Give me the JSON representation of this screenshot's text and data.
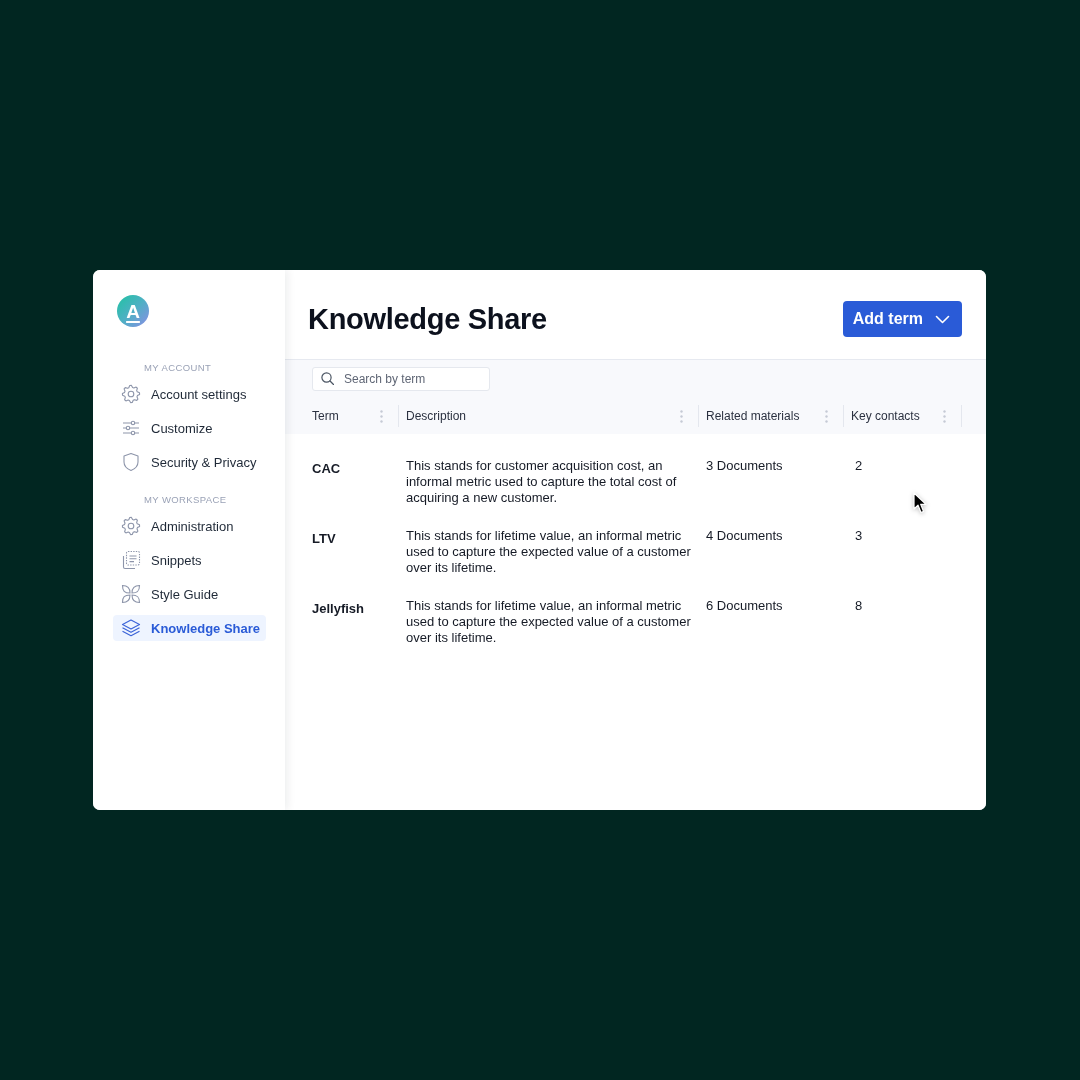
{
  "logo": {
    "letter": "A"
  },
  "sidebar": {
    "sections": [
      {
        "heading": "MY ACCOUNT",
        "items": [
          {
            "label": "Account settings",
            "selected": false
          },
          {
            "label": "Customize",
            "selected": false
          },
          {
            "label": "Security & Privacy",
            "selected": false
          }
        ]
      },
      {
        "heading": "MY WORKSPACE",
        "items": [
          {
            "label": "Administration",
            "selected": false
          },
          {
            "label": "Snippets",
            "selected": false
          },
          {
            "label": "Style Guide",
            "selected": false
          },
          {
            "label": "Knowledge Share",
            "selected": true
          }
        ]
      }
    ]
  },
  "header": {
    "title": "Knowledge Share",
    "add_button": {
      "label": "Add term"
    }
  },
  "search": {
    "placeholder": "Search by term"
  },
  "table": {
    "columns": [
      {
        "label": "Term"
      },
      {
        "label": "Description"
      },
      {
        "label": "Related materials"
      },
      {
        "label": "Key contacts"
      }
    ],
    "rows": [
      {
        "term": "CAC",
        "description": "This stands for customer acquisition cost, an informal metric used to capture the total cost of acquiring a new customer.",
        "related_materials": "3 Documents",
        "key_contacts": "2"
      },
      {
        "term": "LTV",
        "description": "This stands for lifetime value, an informal metric used to capture the expected value of a customer over its lifetime.",
        "related_materials": "4 Documents",
        "key_contacts": "3"
      },
      {
        "term": "Jellyfish",
        "description": "This stands for lifetime value, an informal metric used to capture the expected value of a customer over its lifetime.",
        "related_materials": "6 Documents",
        "key_contacts": "8"
      }
    ]
  }
}
